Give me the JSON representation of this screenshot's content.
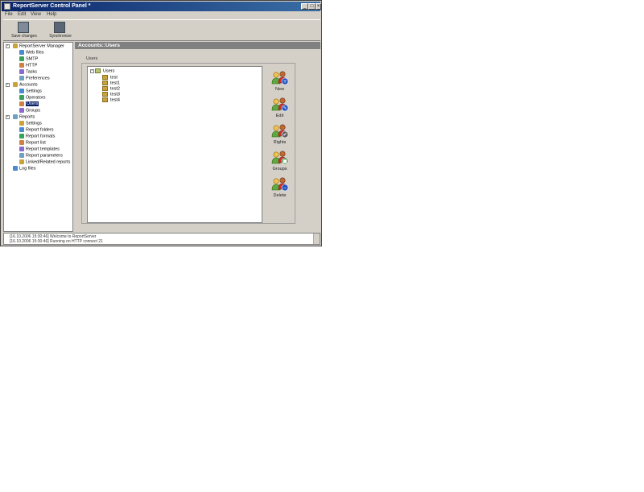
{
  "window": {
    "title": "ReportServer Control Panel *"
  },
  "menu": [
    "File",
    "Edit",
    "View",
    "Help"
  ],
  "toolbar": [
    {
      "label": "Save changes",
      "icon": "save-icon"
    },
    {
      "label": "Synchronize",
      "icon": "sync-icon"
    }
  ],
  "tree": [
    {
      "label": "ReportServer Manager",
      "icon": "server-icon",
      "level": 0,
      "expander": "-"
    },
    {
      "label": "Web files",
      "icon": "folder-icon",
      "level": 1
    },
    {
      "label": "SMTP",
      "icon": "mail-icon",
      "level": 1
    },
    {
      "label": "HTTP",
      "icon": "globe-icon",
      "level": 1
    },
    {
      "label": "Tasks",
      "icon": "task-icon",
      "level": 1
    },
    {
      "label": "Preferences",
      "icon": "prefs-icon",
      "level": 1
    },
    {
      "label": "Accounts",
      "icon": "accounts-icon",
      "level": 0,
      "expander": "-"
    },
    {
      "label": "Settings",
      "icon": "settings-icon",
      "level": 1
    },
    {
      "label": "Operators",
      "icon": "operators-icon",
      "level": 1
    },
    {
      "label": "Users",
      "icon": "users-icon",
      "level": 1,
      "selected": true
    },
    {
      "label": "Groups",
      "icon": "groups-icon",
      "level": 1
    },
    {
      "label": "Reports",
      "icon": "reports-icon",
      "level": 0,
      "expander": "-"
    },
    {
      "label": "Settings",
      "icon": "settings-icon",
      "level": 1
    },
    {
      "label": "Report folders",
      "icon": "report-folder-icon",
      "level": 1
    },
    {
      "label": "Report formats",
      "icon": "report-format-icon",
      "level": 1
    },
    {
      "label": "Report list",
      "icon": "report-list-icon",
      "level": 1
    },
    {
      "label": "Report templates",
      "icon": "report-template-icon",
      "level": 1
    },
    {
      "label": "Report parameters",
      "icon": "report-param-icon",
      "level": 1
    },
    {
      "label": "Linked/Related reports",
      "icon": "linked-icon",
      "level": 1
    },
    {
      "label": "Log files",
      "icon": "log-icon",
      "level": 0
    }
  ],
  "panel": {
    "header": "Accounts::Users",
    "group_label": "Users",
    "root_label": "Users",
    "users": [
      "test",
      "test1",
      "test2",
      "test3",
      "test4"
    ]
  },
  "actions": [
    {
      "label": "New",
      "badge": "+",
      "badge_color": "#2050c0"
    },
    {
      "label": "Edit",
      "badge": "✎",
      "badge_color": "#2050c0"
    },
    {
      "label": "Rights",
      "badge": "✔",
      "badge_color": "#606060"
    },
    {
      "label": "Groups",
      "badge": "■",
      "badge_color": "#308030"
    },
    {
      "label": "Delete",
      "badge": "−",
      "badge_color": "#2050c0"
    }
  ],
  "log": [
    "[16.10.2006 15:30:46] Welcome to ReportServer",
    "[16.10.2006 15:30:46] Running on HTTP connect 21"
  ],
  "colors": {
    "title_start": "#0a246a",
    "title_end": "#3a6ea5",
    "selection": "#0a246a",
    "header": "#808080"
  }
}
